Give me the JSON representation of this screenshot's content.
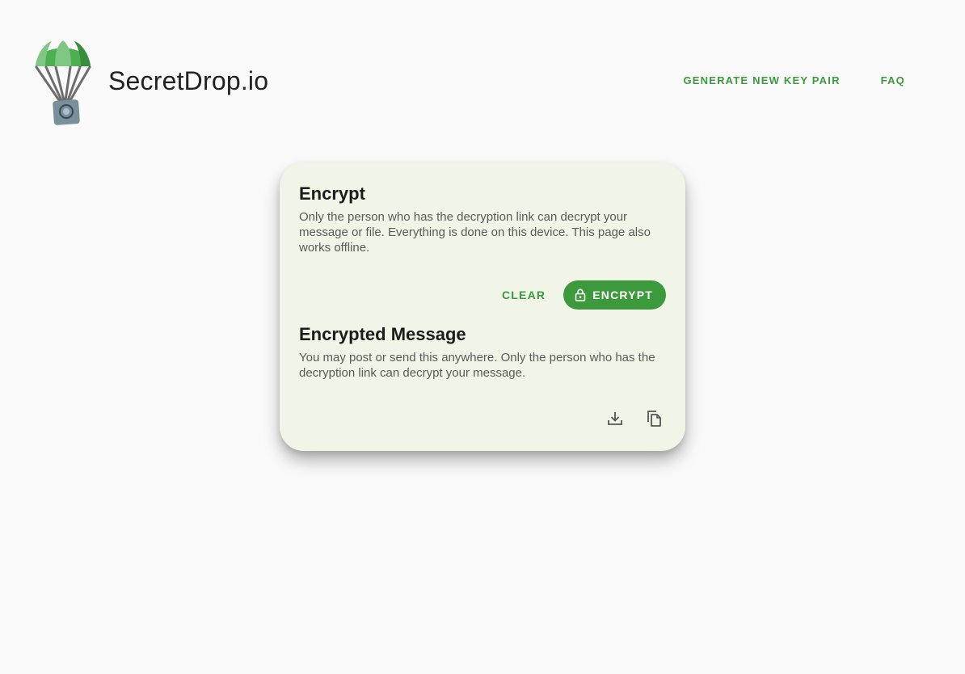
{
  "header": {
    "brand": "SecretDrop.io",
    "nav": [
      {
        "label": "GENERATE NEW KEY PAIR"
      },
      {
        "label": "FAQ"
      }
    ]
  },
  "card": {
    "encrypt_title": "Encrypt",
    "encrypt_desc": "Only the person who has the decryption link can decrypt your message or file. Everything is done on this device. This page also works offline.",
    "clear_label": "CLEAR",
    "encrypt_label": "ENCRYPT",
    "encrypt_icon": "lock-icon",
    "encrypted_title": "Encrypted Message",
    "encrypted_desc": "You may post or send this anywhere. Only the person who has the decryption link can decrypt your message.",
    "icons": [
      "download-icon",
      "copy-icon"
    ]
  },
  "colors": {
    "accent": "#3c9a3c",
    "card_bg": "#f0f5e7",
    "page_bg": "#fafafa"
  }
}
